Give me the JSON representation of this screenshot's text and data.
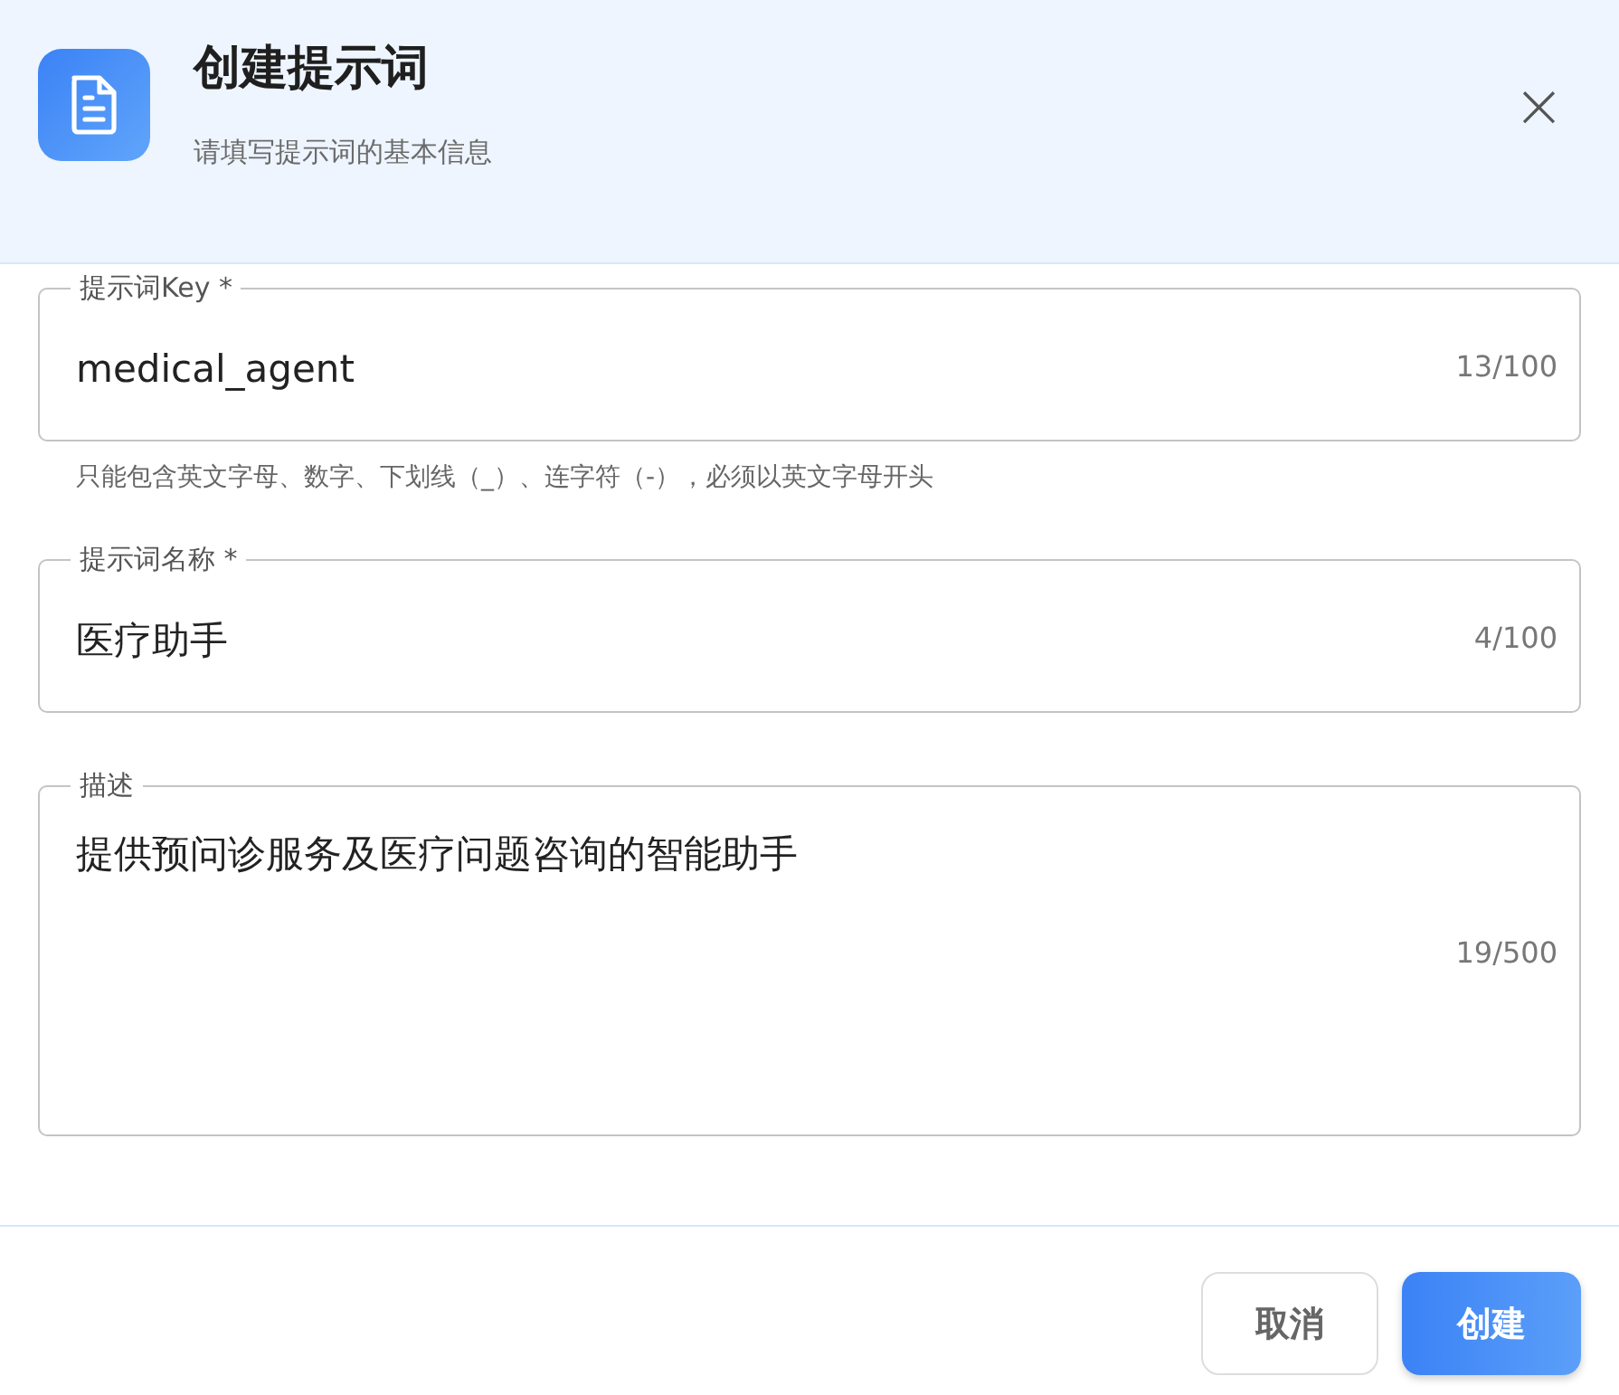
{
  "dialog": {
    "title": "创建提示词",
    "subtitle": "请填写提示词的基本信息",
    "close": "×"
  },
  "fields": [
    {
      "kind": "text",
      "label": "提示词Key *",
      "value": "medical_agent",
      "counter": "13/100",
      "helper": "只能包含英文字母、数字、下划线（_）、连字符（-），必须以英文字母开头"
    },
    {
      "kind": "text",
      "label": "提示词名称 *",
      "value": "医疗助手",
      "counter": "4/100"
    },
    {
      "kind": "textarea",
      "label": "描述",
      "value": "提供预问诊服务及医疗问题咨询的智能助手",
      "counter": "19/500"
    }
  ],
  "buttons": [
    {
      "label": "取消",
      "kind": "secondary"
    },
    {
      "label": "创建",
      "kind": "primary"
    }
  ]
}
